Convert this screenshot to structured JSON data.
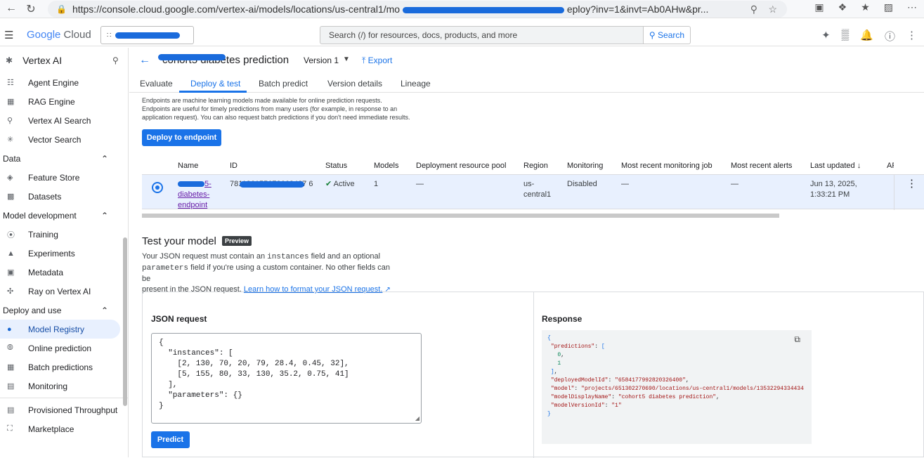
{
  "browser": {
    "url": "https://console.cloud.google.com/vertex-ai/models/locations/us-central1/mo",
    "url_tail": "eploy?inv=1&invt=Ab0AHw&pr..."
  },
  "topbar": {
    "brand_google": "Google",
    "brand_cloud": "Cloud",
    "search_placeholder": "Search (/) for resources, docs, products, and more",
    "search_button": "Search"
  },
  "sidebar": {
    "title": "Vertex AI",
    "items_top": [
      {
        "label": "Agent Engine",
        "icon": "agent-icon"
      },
      {
        "label": "RAG Engine",
        "icon": "rag-icon"
      },
      {
        "label": "Vertex AI Search",
        "icon": "search-icon"
      },
      {
        "label": "Vector Search",
        "icon": "vector-icon"
      }
    ],
    "section_data": "Data",
    "items_data": [
      {
        "label": "Feature Store",
        "icon": "feature-store-icon"
      },
      {
        "label": "Datasets",
        "icon": "datasets-icon"
      }
    ],
    "section_dev": "Model development",
    "items_dev": [
      {
        "label": "Training",
        "icon": "training-icon"
      },
      {
        "label": "Experiments",
        "icon": "experiments-icon"
      },
      {
        "label": "Metadata",
        "icon": "metadata-icon"
      },
      {
        "label": "Ray on Vertex AI",
        "icon": "ray-icon"
      }
    ],
    "section_deploy": "Deploy and use",
    "items_deploy": [
      {
        "label": "Model Registry",
        "icon": "bulb-icon",
        "active": true
      },
      {
        "label": "Online prediction",
        "icon": "broadcast-icon"
      },
      {
        "label": "Batch predictions",
        "icon": "batch-icon"
      },
      {
        "label": "Monitoring",
        "icon": "monitoring-icon"
      }
    ],
    "item_throughput": "Provisioned Throughput",
    "item_marketplace": "Marketplace"
  },
  "header": {
    "model_title": "cohort5 diabetes prediction",
    "version": "Version 1",
    "export": "Export"
  },
  "tabs": [
    "Evaluate",
    "Deploy & test",
    "Batch predict",
    "Version details",
    "Lineage"
  ],
  "intro": {
    "line1": "Endpoints are machine learning models made available for online prediction requests.",
    "line2": "Endpoints are useful for timely predictions from many users (for example, in response to an",
    "line3": "application request). You can also request batch predictions if you don't need immediate results.",
    "deploy_button": "Deploy to endpoint"
  },
  "endpoints_table": {
    "columns": [
      "Name",
      "ID",
      "Status",
      "Models",
      "Deployment resource pool",
      "Region",
      "Monitoring",
      "Most recent monitoring job",
      "Most recent alerts",
      "Last updated",
      "AP"
    ],
    "row": {
      "name_line1": "5-",
      "name_line2": "diabetes-",
      "name_line3": "endpoint",
      "id": "781126155672668487 6",
      "status": "Active",
      "models": "1",
      "pool": "—",
      "region_line1": "us-",
      "region_line2": "central1",
      "monitoring": "Disabled",
      "monitoring_job": "—",
      "alerts": "—",
      "updated_line1": "Jun 13, 2025,",
      "updated_line2": "1:33:21 PM"
    }
  },
  "test": {
    "title": "Test your model",
    "badge": "Preview",
    "desc_a": "Your JSON request must contain an ",
    "desc_code1": "instances",
    "desc_b": " field and an optional",
    "desc_code2": "parameters",
    "desc_c": " field if you're using a custom container. No other fields can be",
    "desc_d": "present in the JSON request. ",
    "learn_link": "Learn how to format your JSON request.",
    "json_label": "JSON request",
    "json_body": "{\n  \"instances\": [\n    [2, 130, 70, 20, 79, 28.4, 0.45, 32],\n    [5, 155, 80, 33, 130, 35.2, 0.75, 41]\n  ],\n  \"parameters\": {}\n}",
    "predict_button": "Predict",
    "response_label": "Response",
    "response": {
      "deployedModelId": "6584177992820326400",
      "model": "projects/651302270690/locations/us-central1/models/13532294334434",
      "modelDisplayName": "cohort5 diabetes prediction",
      "modelVersionId": "1",
      "predictions": [
        "0",
        "1"
      ]
    }
  }
}
